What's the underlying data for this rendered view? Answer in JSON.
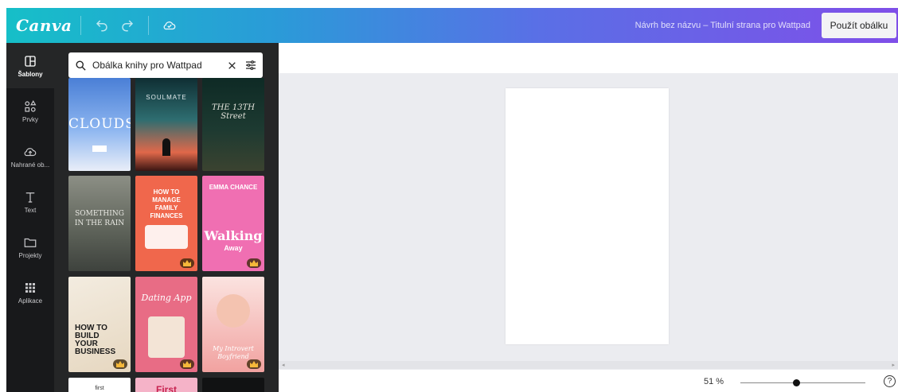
{
  "topbar": {
    "logo": "Canva",
    "document_title": "Návrh bez názvu – Titulní strana pro Wattpad",
    "apply_button": "Použít obálku"
  },
  "rail": {
    "items": [
      {
        "label": "Šablony",
        "icon": "template-icon",
        "active": true
      },
      {
        "label": "Prvky",
        "icon": "elements-icon",
        "active": false
      },
      {
        "label": "Nahrané ob...",
        "icon": "upload-cloud-icon",
        "active": false
      },
      {
        "label": "Text",
        "icon": "text-icon",
        "active": false
      },
      {
        "label": "Projekty",
        "icon": "folder-icon",
        "active": false
      },
      {
        "label": "Aplikace",
        "icon": "apps-icon",
        "active": false
      }
    ]
  },
  "search": {
    "value": "Obálka knihy pro Wattpad"
  },
  "templates": [
    {
      "text": "CLOUDS"
    },
    {
      "text": "SOULMATE"
    },
    {
      "text": "THE 13TH Street"
    },
    {
      "text": "SOMETHING IN THE RAIN"
    },
    {
      "text": "HOW TO MANAGE FAMILY FINANCES"
    },
    {
      "text": "EMMA CHANCE",
      "title": "Walking",
      "sub": "Away"
    },
    {
      "text": "HOW TO BUILD YOUR BUSINESS"
    },
    {
      "text": "Dating App"
    },
    {
      "text": "My Introvert Boyfriend"
    },
    {
      "text": "first"
    },
    {
      "text": "First"
    },
    {
      "text": ""
    }
  ],
  "zoom": {
    "label": "51 %",
    "value": 0.45
  },
  "help": "?",
  "colors": {
    "gradient_start": "#16bfc8",
    "gradient_end": "#7f4fe8",
    "rail_bg": "#18191b",
    "panel_bg": "#252627",
    "workspace_bg": "#ebecf0"
  }
}
